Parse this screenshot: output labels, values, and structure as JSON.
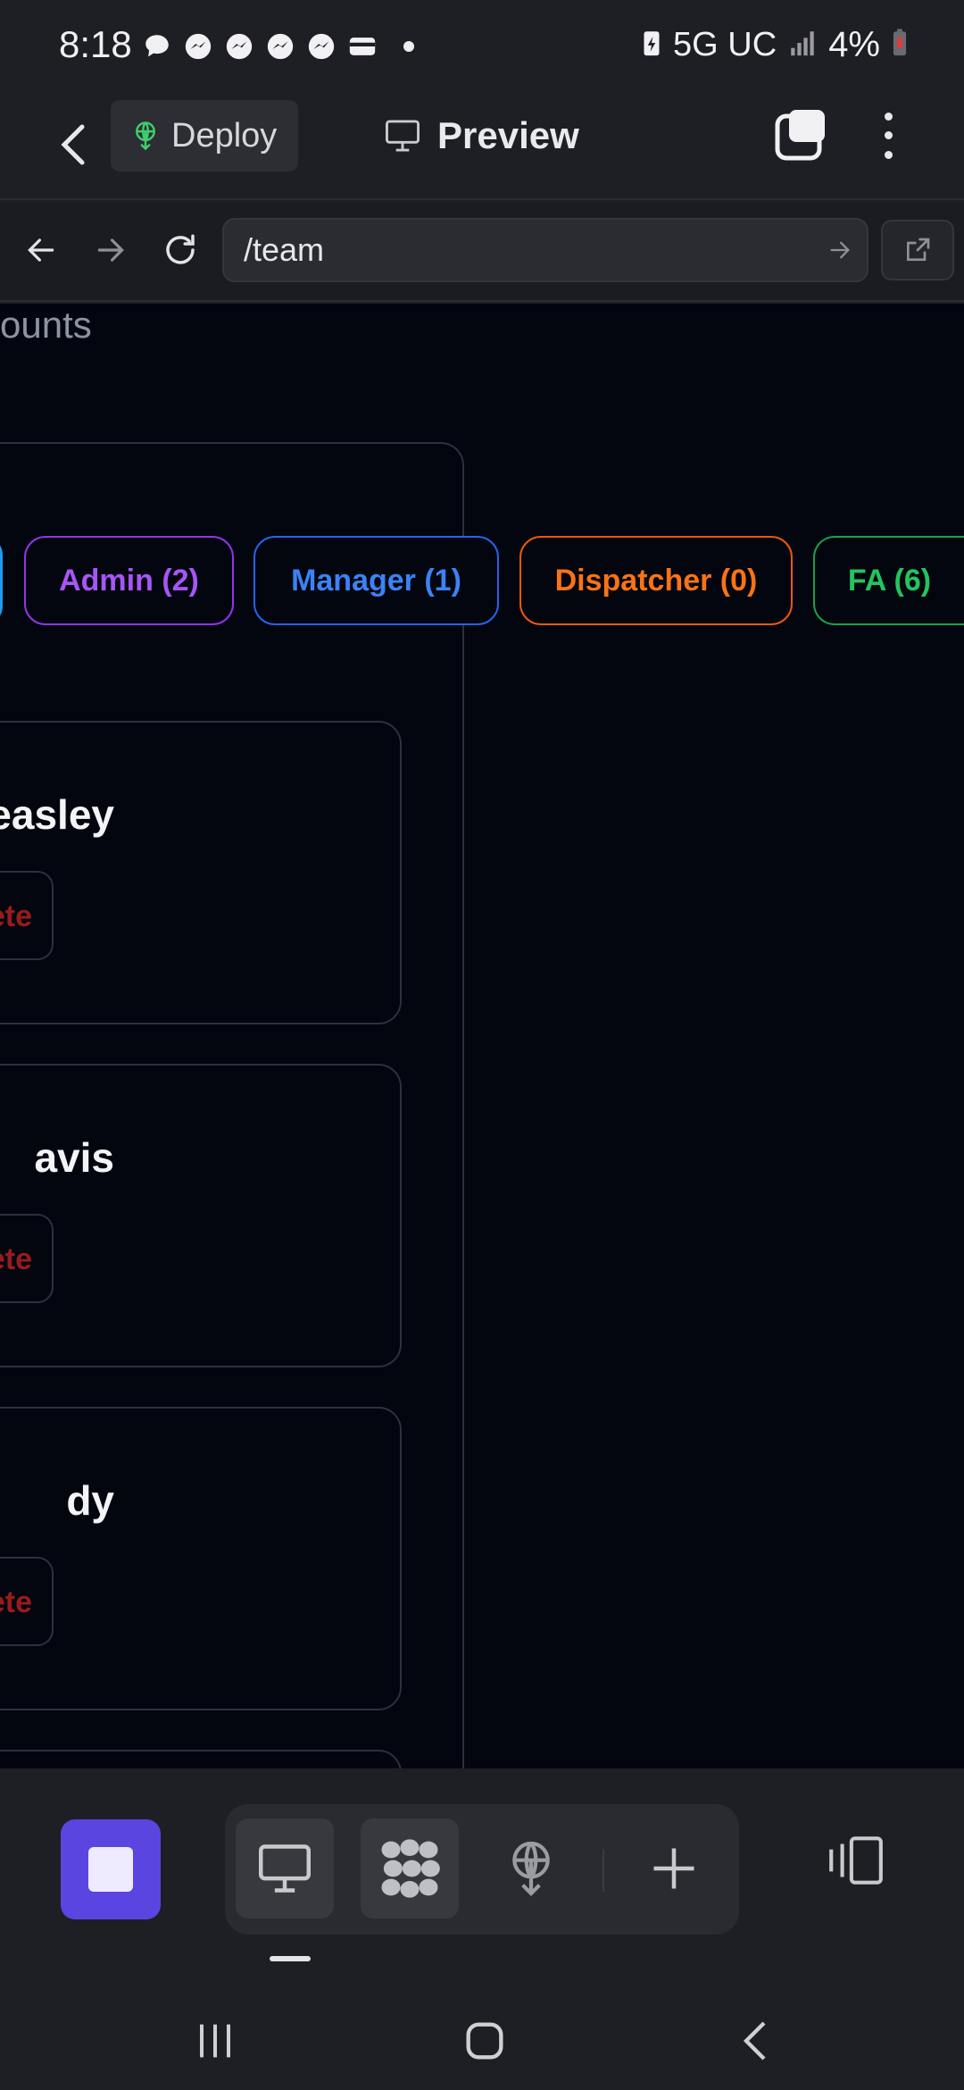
{
  "status_bar": {
    "time": "8:18",
    "notifications": [
      "chat-bubble-icon",
      "messenger-icon",
      "messenger-icon",
      "messenger-icon",
      "messenger-icon",
      "wallet-icon"
    ],
    "network": "5G UC",
    "battery": "4%"
  },
  "app_bar": {
    "deploy_label": "Deploy",
    "preview_label": "Preview"
  },
  "browser": {
    "url": "/team"
  },
  "page": {
    "heading_partial": "ounts",
    "filters": {
      "admin": "Admin (2)",
      "manager": "Manager (1)",
      "dispatcher": "Dispatcher (0)",
      "fa": "FA (6)"
    },
    "cards": [
      {
        "name": "easley",
        "action": "ete"
      },
      {
        "name": "avis",
        "action": "ete"
      },
      {
        "name": "dy",
        "action": "ete"
      }
    ]
  },
  "colors": {
    "admin": "#a855f7",
    "manager": "#3b82f6",
    "dispatcher": "#f97316",
    "fa": "#22c55e",
    "delete": "#991b1b",
    "stop_button": "#5b45e0"
  }
}
